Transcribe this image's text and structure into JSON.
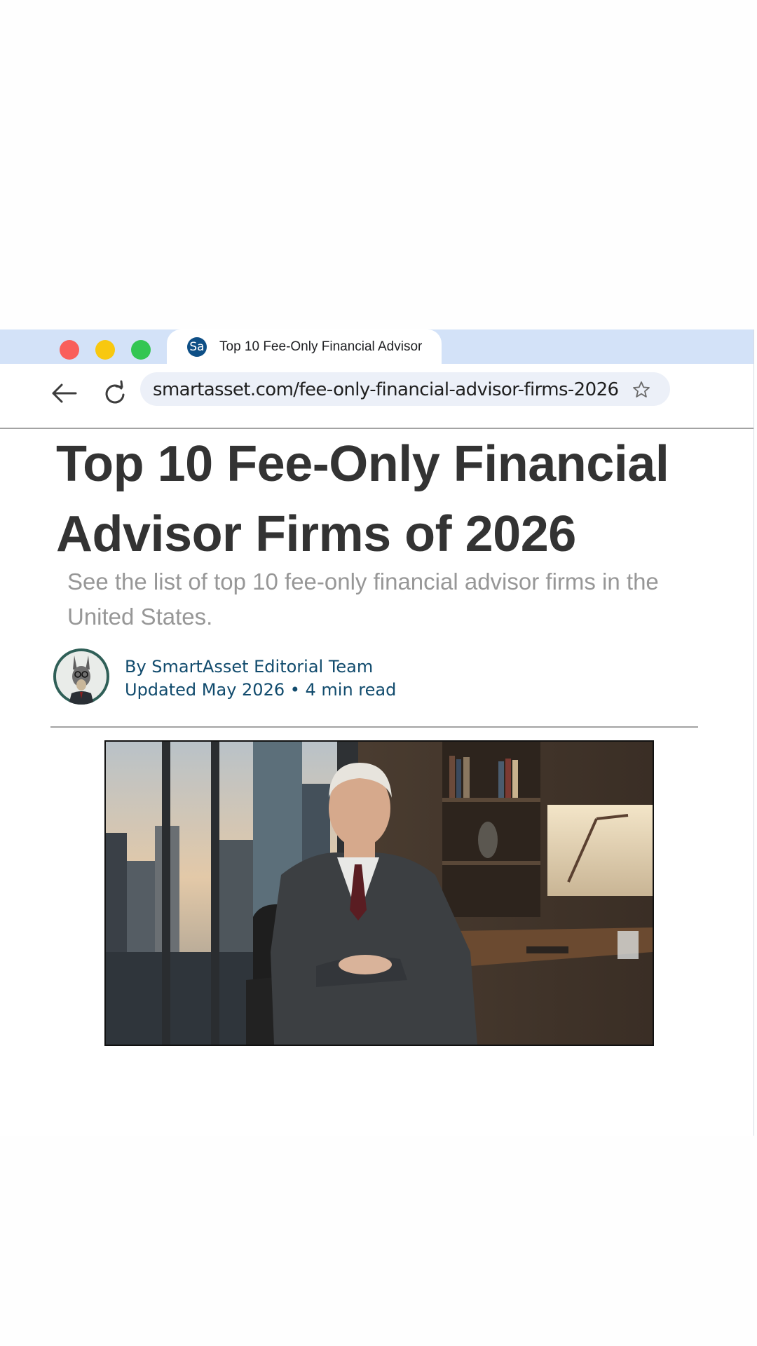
{
  "browser": {
    "tab": {
      "favicon_text": "Sa",
      "title": "Top 10 Fee-Only Financial Advisor"
    },
    "address_bar": {
      "url": "smartasset.com/fee-only-financial-advisor-firms-2026"
    },
    "icons": {
      "back": "arrow-left-icon",
      "reload": "reload-icon",
      "bookmark": "star-icon"
    },
    "colors": {
      "tabstrip": "#d3e2f8",
      "close": "#f95f5b",
      "minimize": "#f8c80f",
      "maximize": "#33c653"
    }
  },
  "article": {
    "headline": "Top 10 Fee-Only Financial Advisor Firms of 2026",
    "subtitle": "See the list of top 10 fee-only financial advisor firms in the United States.",
    "author": "By SmartAsset Editorial Team",
    "meta": "Updated May 2026 • 4 min read",
    "colors": {
      "headline": "#333333",
      "subtitle": "#979797",
      "byline": "#114b6d"
    }
  }
}
